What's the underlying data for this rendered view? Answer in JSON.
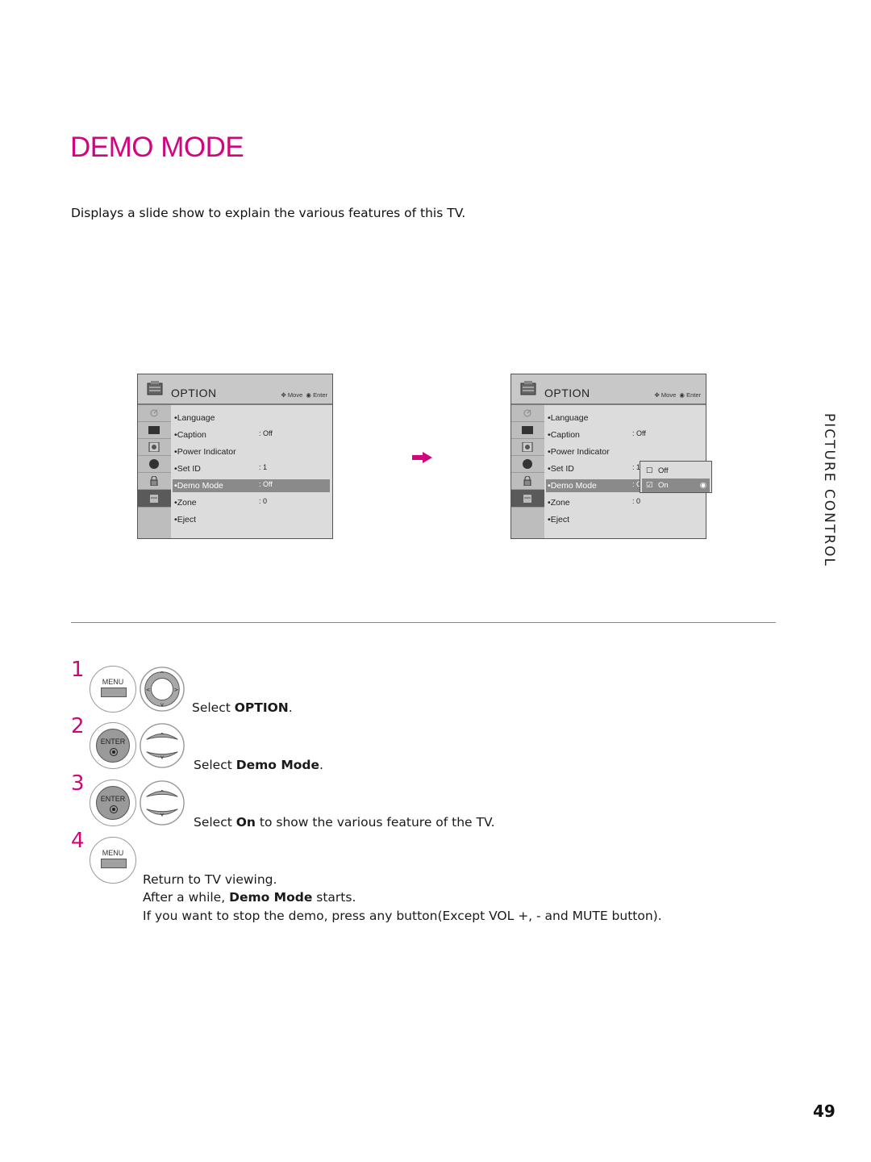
{
  "page": {
    "title": "DEMO MODE",
    "intro": "Displays a slide show to explain the various features of this TV.",
    "side_label": "PICTURE CONTROL",
    "page_number": "49",
    "accent_color": "#d1057e"
  },
  "osd_before": {
    "title": "OPTION",
    "hint_move": "Move",
    "hint_enter": "Enter",
    "tabs": [
      "satellite-dish-icon",
      "tv-screen-icon",
      "audio-icon",
      "time-clock-icon",
      "lock-icon",
      "option-icon"
    ],
    "items": [
      {
        "label": "Language",
        "value": ""
      },
      {
        "label": "Caption",
        "value": ": Off"
      },
      {
        "label": "Power Indicator",
        "value": ""
      },
      {
        "label": "Set ID",
        "value": ": 1"
      },
      {
        "label": "Demo Mode",
        "value": ": Off",
        "selected": true
      },
      {
        "label": "Zone",
        "value": ": 0"
      },
      {
        "label": "Eject",
        "value": ""
      }
    ]
  },
  "osd_after": {
    "title": "OPTION",
    "hint_move": "Move",
    "hint_enter": "Enter",
    "items": [
      {
        "label": "Language",
        "value": ""
      },
      {
        "label": "Caption",
        "value": ": Off"
      },
      {
        "label": "Power Indicator",
        "value": ""
      },
      {
        "label": "Set ID",
        "value": ": 1"
      },
      {
        "label": "Demo Mode",
        "value": ": O",
        "selected": true
      },
      {
        "label": "Zone",
        "value": ": 0"
      },
      {
        "label": "Eject",
        "value": ""
      }
    ],
    "popup": {
      "options": [
        {
          "label": "Off",
          "checked": false,
          "selected": false
        },
        {
          "label": "On",
          "checked": true,
          "selected": true
        }
      ]
    }
  },
  "steps": [
    {
      "number": "1",
      "buttons": [
        "MENU",
        "nav-4way"
      ],
      "text_pre": "Select ",
      "text_bold": "OPTION",
      "text_post": "."
    },
    {
      "number": "2",
      "buttons": [
        "ENTER",
        "nav-updown"
      ],
      "text_pre": "Select ",
      "text_bold": "Demo Mode",
      "text_post": "."
    },
    {
      "number": "3",
      "buttons": [
        "ENTER",
        "nav-updown"
      ],
      "text_pre": "Select ",
      "text_bold": "On",
      "text_post": " to show the various feature of the TV."
    },
    {
      "number": "4",
      "buttons": [
        "MENU"
      ],
      "lines": [
        {
          "text_pre": "Return to TV viewing.",
          "text_bold": "",
          "text_post": ""
        },
        {
          "text_pre": "After a while, ",
          "text_bold": "Demo Mode",
          "text_post": " starts."
        },
        {
          "text_pre": "If you want to stop the demo, press any button(Except VOL +, - and MUTE button).",
          "text_bold": "",
          "text_post": ""
        }
      ]
    }
  ],
  "buttons": {
    "menu_label": "MENU",
    "enter_label": "ENTER"
  }
}
